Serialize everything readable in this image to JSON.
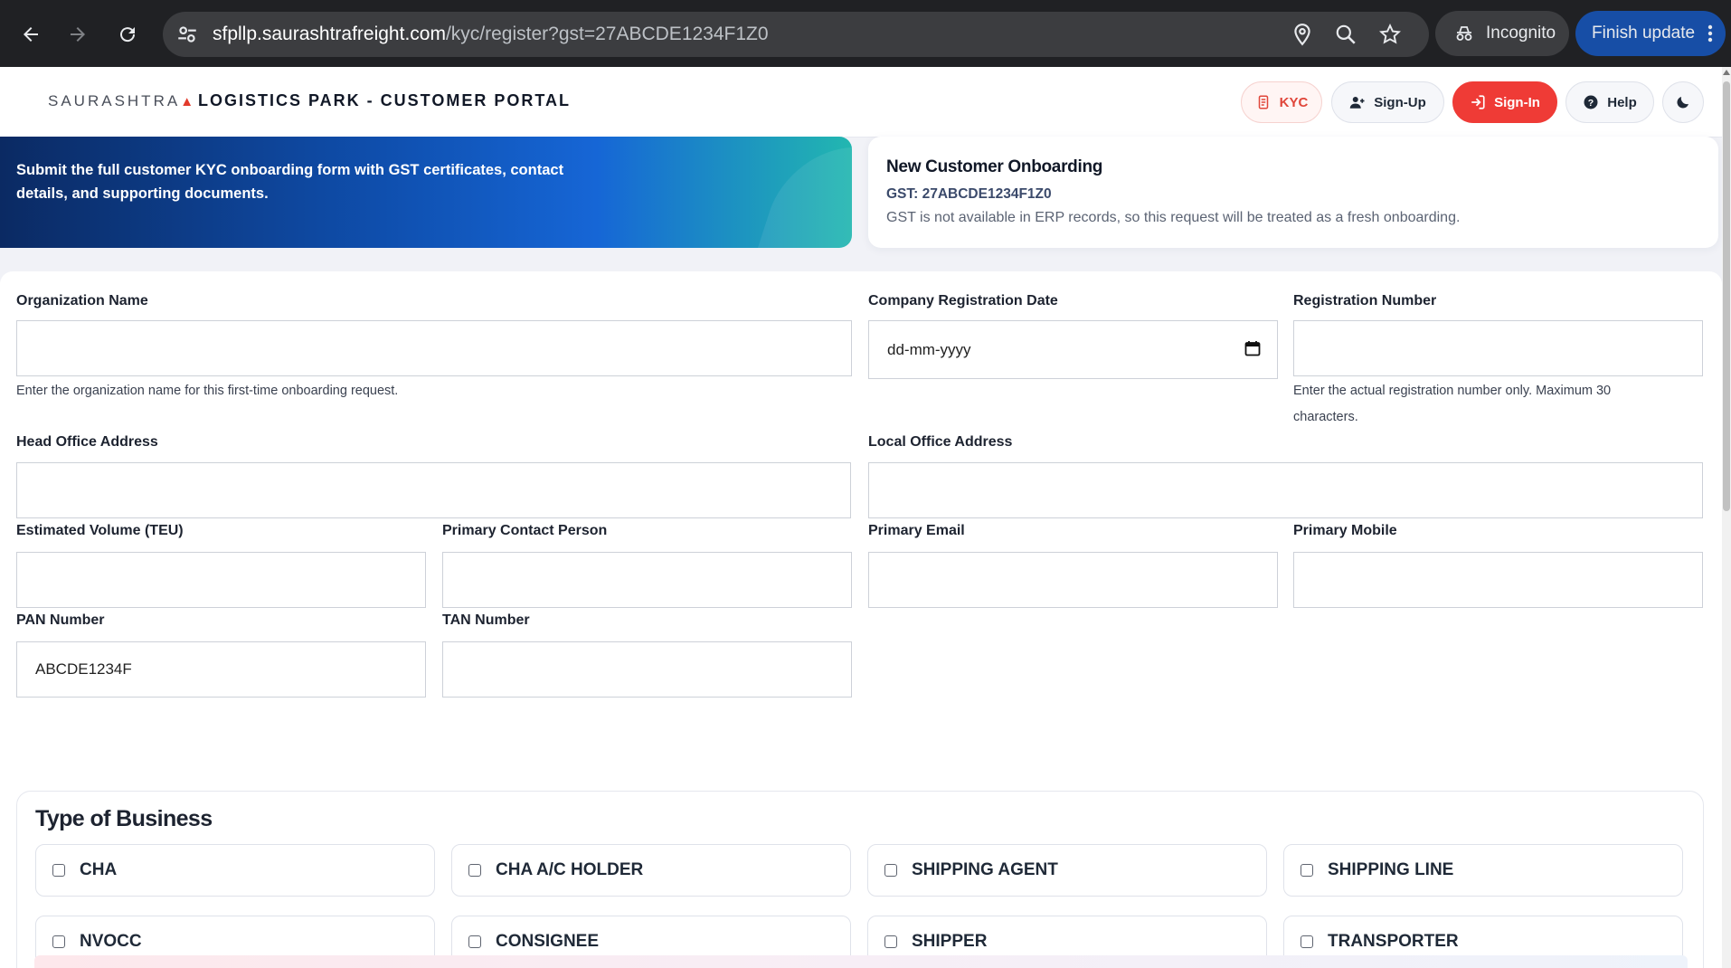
{
  "browser": {
    "url_host": "sfpllp.saurashtrafreight.com",
    "url_path": "/kyc/register?gst=27ABCDE1234F1Z0",
    "incognito_label": "Incognito",
    "update_label": "Finish update"
  },
  "header": {
    "brand": "SAURASHTRA",
    "title": "LOGISTICS PARK - CUSTOMER PORTAL",
    "nav": {
      "kyc": "KYC",
      "signup": "Sign-Up",
      "signin": "Sign-In",
      "help": "Help"
    }
  },
  "hero": {
    "description": "Submit the full customer KYC onboarding form with GST certificates, contact details, and supporting documents."
  },
  "onboarding": {
    "title": "New Customer Onboarding",
    "gst": "GST: 27ABCDE1234F1Z0",
    "note": "GST is not available in ERP records, so this request will be treated as a fresh onboarding."
  },
  "form": {
    "org_name": {
      "label": "Organization Name",
      "value": "",
      "hint": "Enter the organization name for this first-time onboarding request."
    },
    "reg_date": {
      "label": "Company Registration Date",
      "placeholder": "dd-mm-yyyy"
    },
    "reg_number": {
      "label": "Registration Number",
      "value": "",
      "hint": "Enter the actual registration number only. Maximum 30 characters."
    },
    "head_office": {
      "label": "Head Office Address",
      "value": ""
    },
    "local_office": {
      "label": "Local Office Address",
      "value": ""
    },
    "volume": {
      "label": "Estimated Volume (TEU)",
      "value": ""
    },
    "contact_person": {
      "label": "Primary Contact Person",
      "value": ""
    },
    "email": {
      "label": "Primary Email",
      "value": ""
    },
    "mobile": {
      "label": "Primary Mobile",
      "value": ""
    },
    "pan": {
      "label": "PAN Number",
      "value": "ABCDE1234F"
    },
    "tan": {
      "label": "TAN Number",
      "value": ""
    }
  },
  "business": {
    "title": "Type of Business",
    "options": [
      "CHA",
      "CHA A/C HOLDER",
      "SHIPPING AGENT",
      "SHIPPING LINE",
      "NVOCC",
      "CONSIGNEE",
      "SHIPPER",
      "TRANSPORTER"
    ]
  },
  "colors": {
    "accent_red": "#ef3b36",
    "hero_start": "#0b2a63",
    "hero_end": "#22b7b0"
  }
}
